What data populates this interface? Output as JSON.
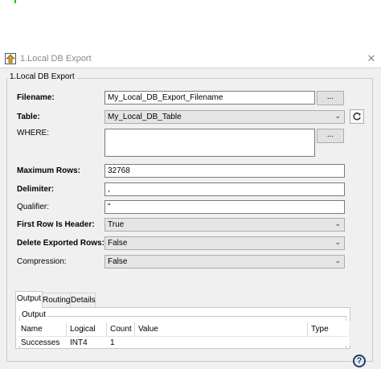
{
  "window": {
    "title": "1.Local DB Export",
    "close_glyph": "✕",
    "app_icon": "export-arrow-icon"
  },
  "form": {
    "group_title": "1.Local DB Export",
    "filename": {
      "label": "Filename:",
      "value": "My_Local_DB_Export_Filename",
      "browse_label": "..."
    },
    "table": {
      "label": "Table:",
      "value": "My_Local_DB_Table",
      "refresh_icon": "refresh-icon"
    },
    "where": {
      "label": "WHERE:",
      "value": "",
      "edit_label": "..."
    },
    "max_rows": {
      "label": "Maximum Rows:",
      "value": "32768"
    },
    "delimiter": {
      "label": "Delimiter:",
      "value": ","
    },
    "qualifier": {
      "label": "Qualifier:",
      "value": "\""
    },
    "first_row_header": {
      "label": "First Row Is Header:",
      "value": "True"
    },
    "delete_exported": {
      "label": "Delete Exported Rows:",
      "value": "False"
    },
    "compression": {
      "label": "Compression:",
      "value": "False"
    }
  },
  "tabs": [
    {
      "label": "Output",
      "active": true
    },
    {
      "label": "Routing",
      "active": false
    },
    {
      "label": "Details",
      "active": false
    }
  ],
  "output": {
    "group_title": "Output",
    "columns": [
      "Name",
      "Logical",
      "Count",
      "Value",
      "Type"
    ],
    "rows": [
      {
        "name": "Successes",
        "logical": "INT4",
        "count": "1",
        "value": "",
        "type": ""
      }
    ]
  },
  "help_glyph": "?",
  "colors": {
    "window_bg": "#f0f0f0",
    "combo_bg": "#e5e5e5",
    "title_text": "#8a8a8a",
    "help_icon": "#1d3c6a",
    "accent_mark": "#00c800"
  }
}
